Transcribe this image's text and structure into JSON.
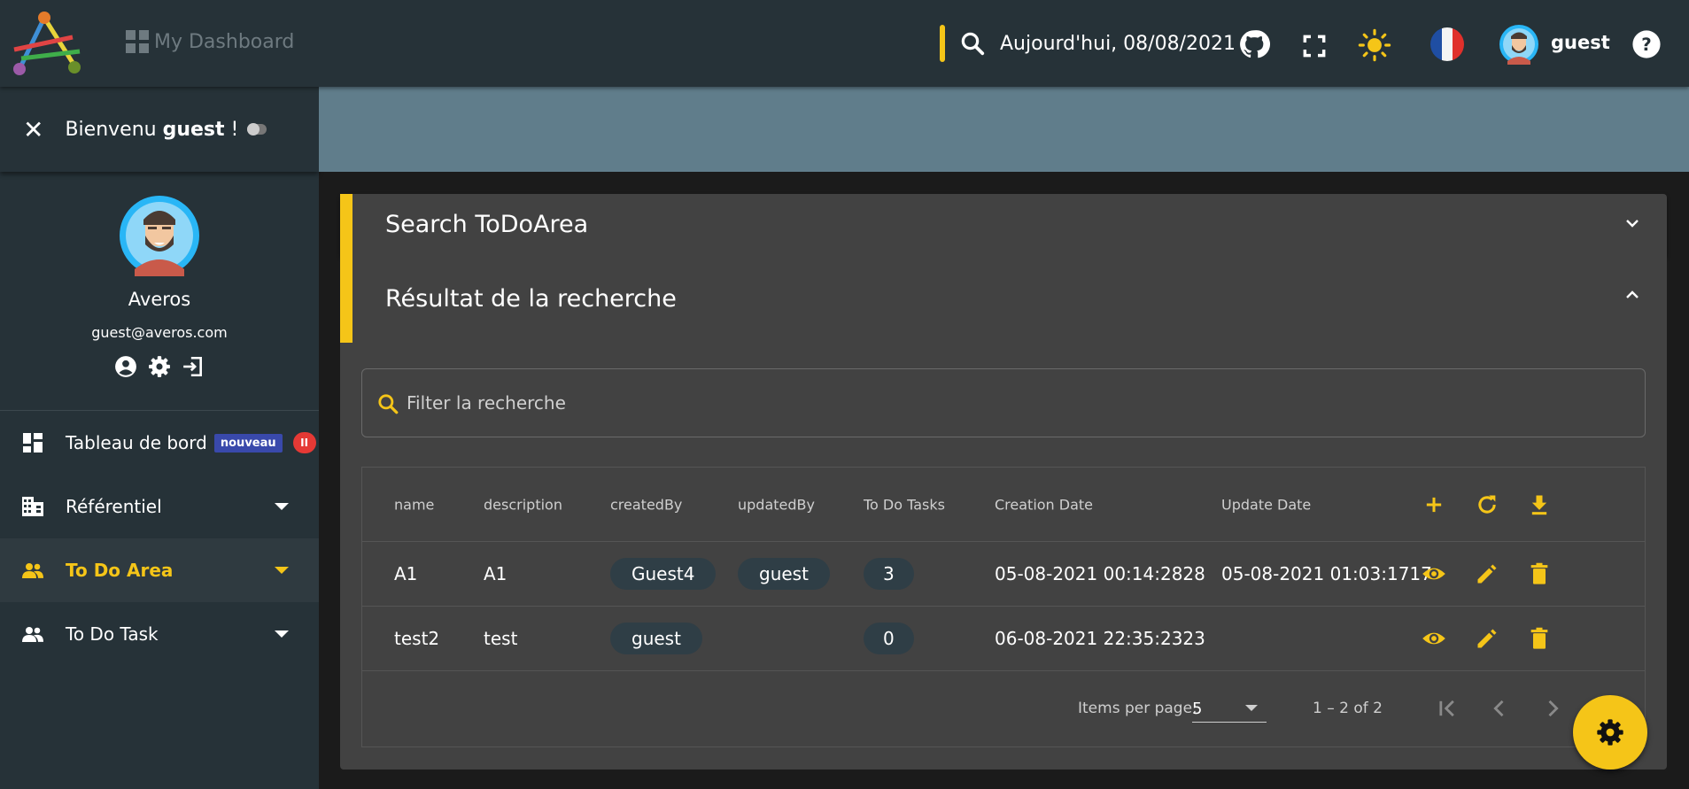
{
  "header": {
    "brand_label": "My Dashboard",
    "date_label": "Aujourd'hui, 08/08/2021",
    "user_label": "guest"
  },
  "sidebar": {
    "welcome_prefix": "Bienvenu ",
    "welcome_user": "guest",
    "welcome_suffix": " !",
    "profile_name": "Averos",
    "profile_email": "guest@averos.com",
    "items": [
      {
        "label": "Tableau de bord",
        "badge": "nouveau",
        "counter": "II"
      },
      {
        "label": "Référentiel"
      },
      {
        "label": "To Do Area"
      },
      {
        "label": "To Do Task"
      }
    ]
  },
  "panels": {
    "search_title": "Search ToDoArea",
    "result_title": "Résultat de la recherche"
  },
  "filter": {
    "placeholder": "Filter la recherche"
  },
  "table": {
    "columns": [
      "name",
      "description",
      "createdBy",
      "updatedBy",
      "To Do Tasks",
      "Creation Date",
      "Update Date"
    ],
    "rows": [
      {
        "name": "A1",
        "description": "A1",
        "createdBy": "Guest4",
        "updatedBy": "guest",
        "tasks": "3",
        "created": "05-08-2021 00:14:2828",
        "updated": "05-08-2021 01:03:1717"
      },
      {
        "name": "test2",
        "description": "test",
        "createdBy": "guest",
        "updatedBy": "",
        "tasks": "0",
        "created": "06-08-2021 22:35:2323",
        "updated": ""
      }
    ]
  },
  "paginator": {
    "items_per_page_label": "Items per page:",
    "page_size": "5",
    "range_label": "1 – 2 of 2"
  },
  "colors": {
    "accent": "#f5c518",
    "topbar": "#263238",
    "banner": "#607d8b",
    "panel": "#424242"
  }
}
